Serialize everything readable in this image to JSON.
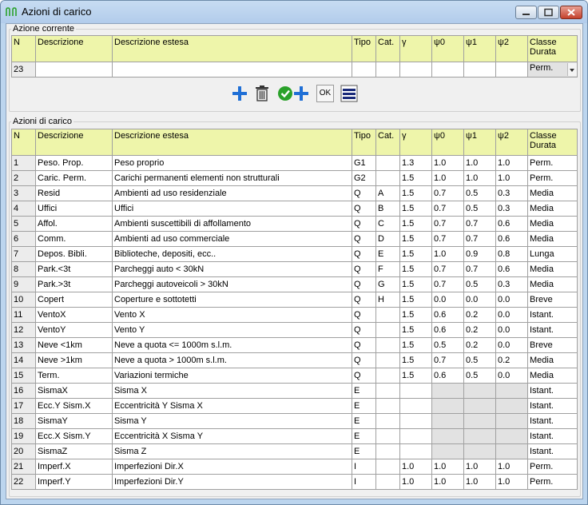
{
  "window": {
    "title": "Azioni di carico"
  },
  "current_group": {
    "label": "Azione corrente"
  },
  "list_group": {
    "label": "Azioni di carico"
  },
  "columns": [
    "N",
    "Descrizione",
    "Descrizione estesa",
    "Tipo",
    "Cat.",
    "γ",
    "ψ0",
    "ψ1",
    "ψ2",
    "Classe Durata"
  ],
  "current": {
    "n": "23",
    "descrizione": "",
    "estesa": "",
    "tipo": "",
    "cat": "",
    "g": "",
    "p0": "",
    "p1": "",
    "p2": "",
    "classe": "Perm."
  },
  "toolbar": {
    "ok_label": "OK"
  },
  "colors": {
    "header_bg": "#eef5aa",
    "accent_blue": "#1f6fd6",
    "accent_green": "#2aa12a"
  },
  "rows": [
    [
      "1",
      "Peso. Prop.",
      "Peso proprio",
      "G1",
      "",
      "1.3",
      "1.0",
      "1.0",
      "1.0",
      "Perm."
    ],
    [
      "2",
      "Caric. Perm.",
      "Carichi permanenti elementi non strutturali",
      "G2",
      "",
      "1.5",
      "1.0",
      "1.0",
      "1.0",
      "Perm."
    ],
    [
      "3",
      "Resid",
      "Ambienti ad uso residenziale",
      "Q",
      "A",
      "1.5",
      "0.7",
      "0.5",
      "0.3",
      "Media"
    ],
    [
      "4",
      "Uffici",
      "Uffici",
      "Q",
      "B",
      "1.5",
      "0.7",
      "0.5",
      "0.3",
      "Media"
    ],
    [
      "5",
      "Affol.",
      "Ambienti suscettibili di affollamento",
      "Q",
      "C",
      "1.5",
      "0.7",
      "0.7",
      "0.6",
      "Media"
    ],
    [
      "6",
      "Comm.",
      "Ambienti ad uso commerciale",
      "Q",
      "D",
      "1.5",
      "0.7",
      "0.7",
      "0.6",
      "Media"
    ],
    [
      "7",
      "Depos. Bibli.",
      "Biblioteche, depositi, ecc..",
      "Q",
      "E",
      "1.5",
      "1.0",
      "0.9",
      "0.8",
      "Lunga"
    ],
    [
      "8",
      "Park.<3t",
      "Parcheggi auto < 30kN",
      "Q",
      "F",
      "1.5",
      "0.7",
      "0.7",
      "0.6",
      "Media"
    ],
    [
      "9",
      "Park.>3t",
      "Parcheggi autoveicoli > 30kN",
      "Q",
      "G",
      "1.5",
      "0.7",
      "0.5",
      "0.3",
      "Media"
    ],
    [
      "10",
      "Copert",
      "Coperture e sottotetti",
      "Q",
      "H",
      "1.5",
      "0.0",
      "0.0",
      "0.0",
      "Breve"
    ],
    [
      "11",
      "VentoX",
      "Vento X",
      "Q",
      "",
      "1.5",
      "0.6",
      "0.2",
      "0.0",
      "Istant."
    ],
    [
      "12",
      "VentoY",
      "Vento Y",
      "Q",
      "",
      "1.5",
      "0.6",
      "0.2",
      "0.0",
      "Istant."
    ],
    [
      "13",
      "Neve <1km",
      "Neve a quota <= 1000m s.l.m.",
      "Q",
      "",
      "1.5",
      "0.5",
      "0.2",
      "0.0",
      "Breve"
    ],
    [
      "14",
      "Neve >1km",
      "Neve a quota > 1000m s.l.m.",
      "Q",
      "",
      "1.5",
      "0.7",
      "0.5",
      "0.2",
      "Media"
    ],
    [
      "15",
      "Term.",
      "Variazioni termiche",
      "Q",
      "",
      "1.5",
      "0.6",
      "0.5",
      "0.0",
      "Media"
    ],
    [
      "16",
      "SismaX",
      "Sisma X",
      "E",
      "",
      "",
      "",
      "",
      "",
      "Istant."
    ],
    [
      "17",
      "Ecc.Y Sism.X",
      "Eccentricità Y Sisma X",
      "E",
      "",
      "",
      "",
      "",
      "",
      "Istant."
    ],
    [
      "18",
      "SismaY",
      "Sisma Y",
      "E",
      "",
      "",
      "",
      "",
      "",
      "Istant."
    ],
    [
      "19",
      "Ecc.X Sism.Y",
      "Eccentricità X Sisma Y",
      "E",
      "",
      "",
      "",
      "",
      "",
      "Istant."
    ],
    [
      "20",
      "SismaZ",
      "Sisma Z",
      "E",
      "",
      "",
      "",
      "",
      "",
      "Istant."
    ],
    [
      "21",
      "Imperf.X",
      "Imperfezioni Dir.X",
      "I",
      "",
      "1.0",
      "1.0",
      "1.0",
      "1.0",
      "Perm."
    ],
    [
      "22",
      "Imperf.Y",
      "Imperfezioni Dir.Y",
      "I",
      "",
      "1.0",
      "1.0",
      "1.0",
      "1.0",
      "Perm."
    ]
  ]
}
